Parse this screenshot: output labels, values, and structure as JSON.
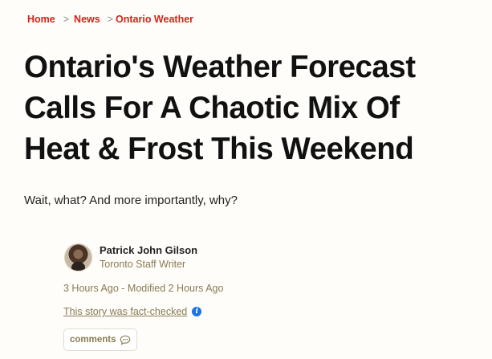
{
  "breadcrumb": {
    "items": [
      "Home",
      "News",
      "Ontario Weather"
    ],
    "separator": ">"
  },
  "article": {
    "title_lines": [
      "Ontario's Weather Forecast",
      "Calls For A Chaotic Mix Of",
      "Heat & Frost This Weekend"
    ],
    "subtitle": "Wait, what? And more importantly, why?"
  },
  "author": {
    "name": "Patrick John Gilson",
    "role": "Toronto Staff Writer"
  },
  "meta": {
    "published": "3 Hours Ago",
    "modified": "- Modified 2 Hours Ago",
    "fact_check": "This story was fact-checked"
  },
  "comments": {
    "label": "comments"
  },
  "colors": {
    "accent": "#d8201a",
    "meta": "#8a7a52",
    "info": "#1a73e8",
    "background": "#fefdf9"
  },
  "icons": {
    "info": "info-icon",
    "comment": "comment-bubble-icon"
  }
}
